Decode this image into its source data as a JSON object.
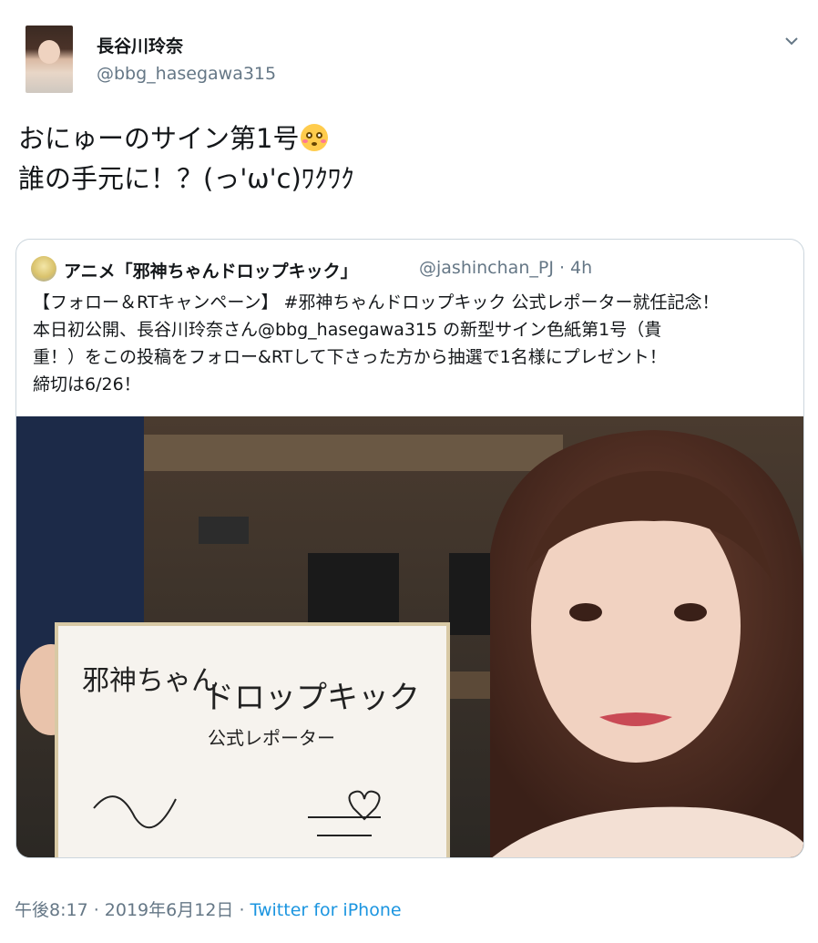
{
  "author": {
    "display_name": "長谷川玲奈",
    "handle": "@bbg_hasegawa315"
  },
  "menu_icon": "chevron-down-icon",
  "tweet": {
    "lines": [
      "おにゅーのサイン第1号",
      "誰の手元に！？(っ'ω'c)ﾜｸﾜｸ"
    ],
    "emoji": "flushed-face-emoji"
  },
  "quoted_tweet": {
    "display_name": "アニメ「邪神ちゃんドロップキック」",
    "handle": "@jashinchan_PJ · 4h",
    "lines": [
      "【フォロー＆RTキャンペーン】 #邪神ちゃんドロップキック 公式レポーター就任記念！",
      "本日初公開、長谷川玲奈さん@bbg_hasegawa315 の新型サイン色紙第1号（貴",
      "重！）をこの投稿をフォロー&RTして下さった方から抽選で1名様にプレゼント！",
      "締切は6/26！"
    ],
    "photo": {
      "board_lines": [
        "邪神ちゃん",
        "ドロップキック",
        "公式レポーター"
      ]
    }
  },
  "footer": {
    "timestamp": "午後8:17 · 2019年6月12日",
    "separator": " · ",
    "source": "Twitter for iPhone"
  },
  "colors": {
    "text": "#14171a",
    "secondary": "#657786",
    "link": "#1b95e0",
    "border": "#ccd6dd"
  }
}
